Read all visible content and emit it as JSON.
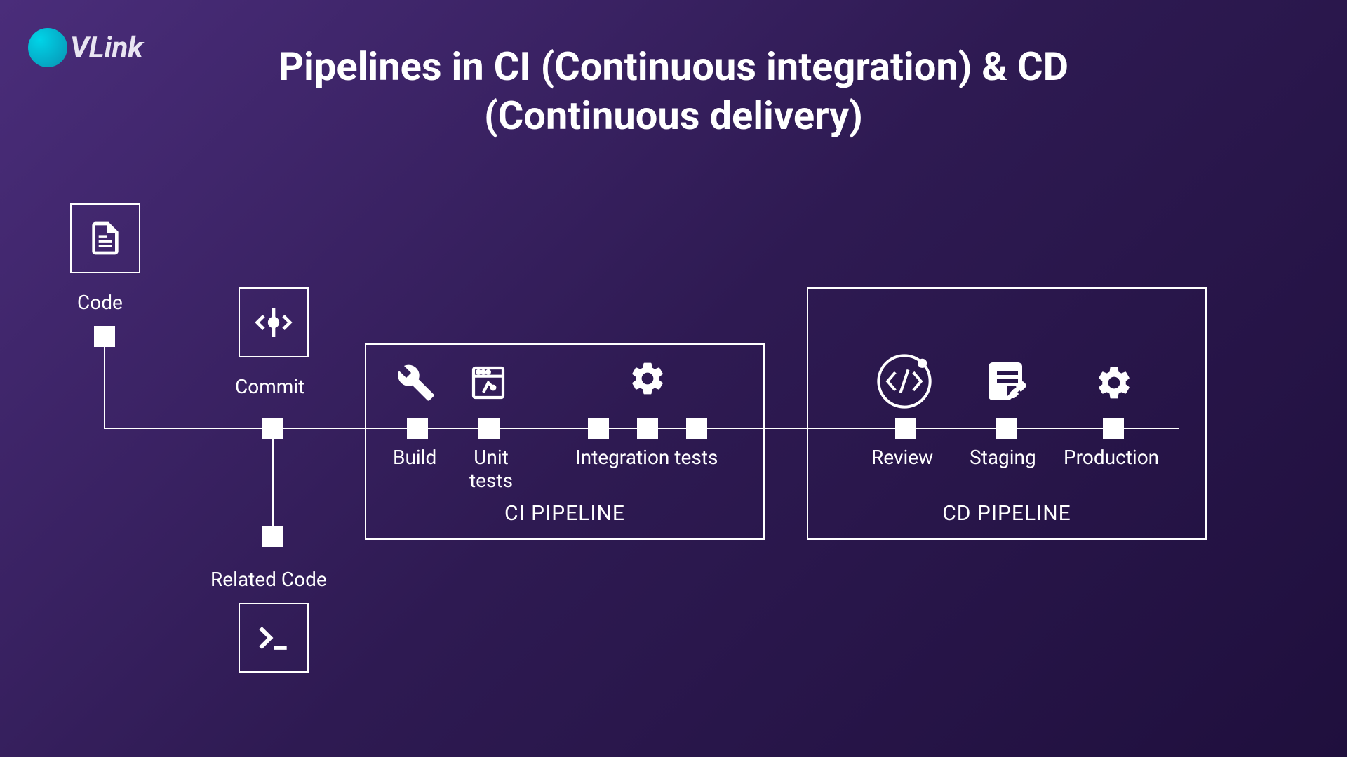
{
  "logo": {
    "text": "VLink"
  },
  "title": "Pipelines in CI (Continuous integration) & CD (Continuous delivery)",
  "stages": {
    "code": "Code",
    "commit": "Commit",
    "related_code": "Related Code",
    "build": "Build",
    "unit_tests": "Unit tests",
    "integration_tests": "Integration tests",
    "review": "Review",
    "staging": "Staging",
    "production": "Production"
  },
  "pipelines": {
    "ci": "CI PIPELINE",
    "cd": "CD PIPELINE"
  }
}
